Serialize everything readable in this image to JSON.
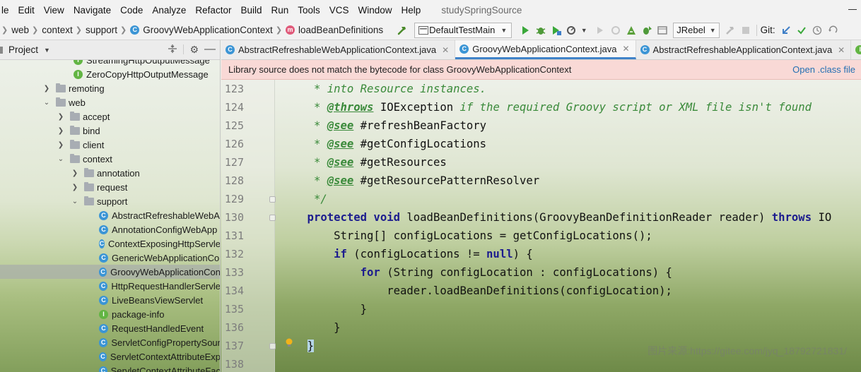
{
  "menu": {
    "items": [
      "le",
      "Edit",
      "View",
      "Navigate",
      "Code",
      "Analyze",
      "Refactor",
      "Build",
      "Run",
      "Tools",
      "VCS",
      "Window",
      "Help"
    ],
    "project_name": "studySpringSource"
  },
  "nav": {
    "breadcrumbs": [
      "web",
      "context",
      "support",
      "GroovyWebApplicationContext",
      "loadBeanDefinitions"
    ],
    "run_config": "DefaultTestMain",
    "jrebel": "JRebel",
    "git_label": "Git:"
  },
  "project_panel": {
    "title": "Project",
    "tree": [
      {
        "indent": 104,
        "arrow": "",
        "icon": "i",
        "label": "StreamingHttpOutputMessage",
        "selected": false
      },
      {
        "indent": 104,
        "arrow": "",
        "icon": "i",
        "label": "ZeroCopyHttpOutputMessage",
        "selected": false
      },
      {
        "indent": 60,
        "arrow": "›",
        "icon": "folder",
        "label": "remoting",
        "selected": false
      },
      {
        "indent": 60,
        "arrow": "⌄",
        "icon": "folder",
        "label": "web",
        "selected": false
      },
      {
        "indent": 80,
        "arrow": "›",
        "icon": "folder",
        "label": "accept",
        "selected": false
      },
      {
        "indent": 80,
        "arrow": "›",
        "icon": "folder",
        "label": "bind",
        "selected": false
      },
      {
        "indent": 80,
        "arrow": "›",
        "icon": "folder",
        "label": "client",
        "selected": false
      },
      {
        "indent": 80,
        "arrow": "⌄",
        "icon": "folder",
        "label": "context",
        "selected": false
      },
      {
        "indent": 100,
        "arrow": "›",
        "icon": "folder",
        "label": "annotation",
        "selected": false
      },
      {
        "indent": 100,
        "arrow": "›",
        "icon": "folder",
        "label": "request",
        "selected": false
      },
      {
        "indent": 100,
        "arrow": "⌄",
        "icon": "folder",
        "label": "support",
        "selected": false
      },
      {
        "indent": 140,
        "arrow": "",
        "icon": "c",
        "label": "AbstractRefreshableWebA",
        "selected": false
      },
      {
        "indent": 140,
        "arrow": "",
        "icon": "c",
        "label": "AnnotationConfigWebApp",
        "selected": false
      },
      {
        "indent": 140,
        "arrow": "",
        "icon": "c",
        "label": "ContextExposingHttpServle",
        "selected": false
      },
      {
        "indent": 140,
        "arrow": "",
        "icon": "c",
        "label": "GenericWebApplicationCo",
        "selected": false
      },
      {
        "indent": 140,
        "arrow": "",
        "icon": "c",
        "label": "GroovyWebApplicationCon",
        "selected": true
      },
      {
        "indent": 140,
        "arrow": "",
        "icon": "c",
        "label": "HttpRequestHandlerServle",
        "selected": false
      },
      {
        "indent": 140,
        "arrow": "",
        "icon": "c",
        "label": "LiveBeansViewServlet",
        "selected": false
      },
      {
        "indent": 140,
        "arrow": "",
        "icon": "i",
        "label": "package-info",
        "selected": false
      },
      {
        "indent": 140,
        "arrow": "",
        "icon": "c",
        "label": "RequestHandledEvent",
        "selected": false
      },
      {
        "indent": 140,
        "arrow": "",
        "icon": "c",
        "label": "ServletConfigPropertySour",
        "selected": false
      },
      {
        "indent": 140,
        "arrow": "",
        "icon": "c",
        "label": "ServletContextAttributeExp",
        "selected": false
      },
      {
        "indent": 140,
        "arrow": "",
        "icon": "c",
        "label": "ServletContextAttributeFac",
        "selected": false
      }
    ]
  },
  "tabs": [
    {
      "label": "AbstractRefreshableWebApplicationContext.java",
      "active": false
    },
    {
      "label": "GroovyWebApplicationContext.java",
      "active": true
    },
    {
      "label": "AbstractRefreshableApplicationContext.java",
      "active": false
    },
    {
      "label": "G",
      "active": false
    }
  ],
  "banner": {
    "message": "Library source does not match the bytecode for class GroovyWebApplicationContext",
    "link": "Open .class file"
  },
  "editor": {
    "lines": [
      {
        "num": "123",
        "segments": [
          [
            "doc",
            "     * into Resource instances."
          ]
        ]
      },
      {
        "num": "124",
        "segments": [
          [
            "doc",
            "     * "
          ],
          [
            "doctag",
            "@throws"
          ],
          [
            "doc",
            " "
          ],
          [
            "plain",
            "IOException"
          ],
          [
            "doc",
            " if the required Groovy script or XML file isn't found"
          ]
        ]
      },
      {
        "num": "125",
        "segments": [
          [
            "doc",
            "     * "
          ],
          [
            "doctag",
            "@see"
          ],
          [
            "doc",
            " "
          ],
          [
            "plain",
            "#refreshBeanFactory"
          ]
        ]
      },
      {
        "num": "126",
        "segments": [
          [
            "doc",
            "     * "
          ],
          [
            "doctag",
            "@see"
          ],
          [
            "doc",
            " "
          ],
          [
            "plain",
            "#getConfigLocations"
          ]
        ]
      },
      {
        "num": "127",
        "segments": [
          [
            "doc",
            "     * "
          ],
          [
            "doctag",
            "@see"
          ],
          [
            "doc",
            " "
          ],
          [
            "plain",
            "#getResources"
          ]
        ]
      },
      {
        "num": "128",
        "segments": [
          [
            "doc",
            "     * "
          ],
          [
            "doctag",
            "@see"
          ],
          [
            "doc",
            " "
          ],
          [
            "plain",
            "#getResourcePatternResolver"
          ]
        ]
      },
      {
        "num": "129",
        "segments": [
          [
            "doc",
            "     */"
          ]
        ]
      },
      {
        "num": "130",
        "segments": [
          [
            "kw",
            "    protected void "
          ],
          [
            "plain",
            "loadBeanDefinitions(GroovyBeanDefinitionReader reader) "
          ],
          [
            "kw",
            "throws "
          ],
          [
            "plain",
            "IO"
          ]
        ]
      },
      {
        "num": "131",
        "segments": [
          [
            "plain",
            "        String[] configLocations = getConfigLocations();"
          ]
        ]
      },
      {
        "num": "132",
        "segments": [
          [
            "kw",
            "        if "
          ],
          [
            "plain",
            "(configLocations != "
          ],
          [
            "kw",
            "null"
          ],
          [
            "plain",
            ") {"
          ]
        ]
      },
      {
        "num": "133",
        "segments": [
          [
            "kw",
            "            for "
          ],
          [
            "plain",
            "(String configLocation : configLocations) {"
          ]
        ]
      },
      {
        "num": "134",
        "segments": [
          [
            "plain",
            "                reader.loadBeanDefinitions(configLocation);"
          ]
        ]
      },
      {
        "num": "135",
        "segments": [
          [
            "plain",
            "            }"
          ]
        ]
      },
      {
        "num": "136",
        "segments": [
          [
            "plain",
            "        }"
          ]
        ]
      },
      {
        "num": "137",
        "segments": [
          [
            "plain",
            "    "
          ],
          [
            "brace",
            "}"
          ]
        ]
      },
      {
        "num": "138",
        "segments": [
          [
            "plain",
            ""
          ]
        ]
      }
    ],
    "watermark": "图片来源:https://gitee.com/jyq_18792721831/"
  },
  "colors": {
    "keyword": "#1c1c8e",
    "doc_comment": "#3a8a3a",
    "class_icon": "#3b95d5",
    "interface_icon": "#62b543",
    "method_icon": "#e05a7a",
    "banner_bg": "#f9d9d6",
    "link": "#2470b3"
  }
}
